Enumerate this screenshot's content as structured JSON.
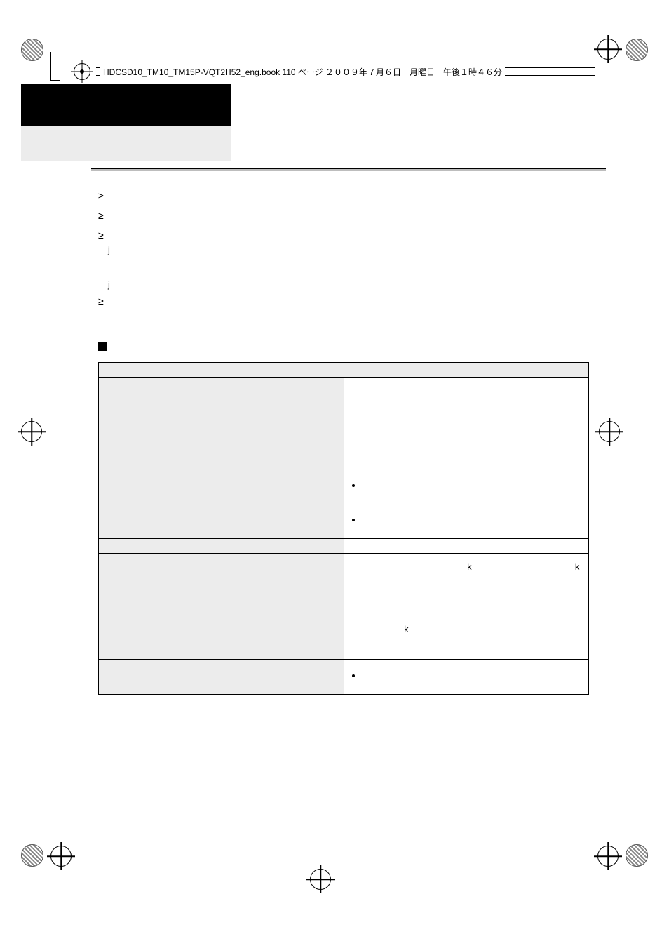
{
  "runhead_text": "HDCSD10_TM10_TM15P-VQT2H52_eng.book  110 ページ  ２００９年７月６日　月曜日　午後１時４６分",
  "bullets": {
    "b1": "",
    "b2": "",
    "b3": "",
    "s1": "",
    "s2": "",
    "b4": ""
  },
  "spec": {
    "r1_label": "",
    "r1_val": "",
    "r2_label": "",
    "r2_val": "",
    "r3_label": "",
    "r3_b1": "",
    "r3_b2": "",
    "r4_label": "",
    "r4_val": "",
    "r5_label": "",
    "r5_val_pre1": "",
    "r5_val_x1": "k",
    "r5_val_mid": "",
    "r5_val_x2": "k",
    "r5_val_post": "",
    "r5_val_line2_pre": "",
    "r5_val_line2_x": "k",
    "r5_val_line2_post": "",
    "r6_label": "",
    "r6_val": "",
    "r6_b1": ""
  }
}
